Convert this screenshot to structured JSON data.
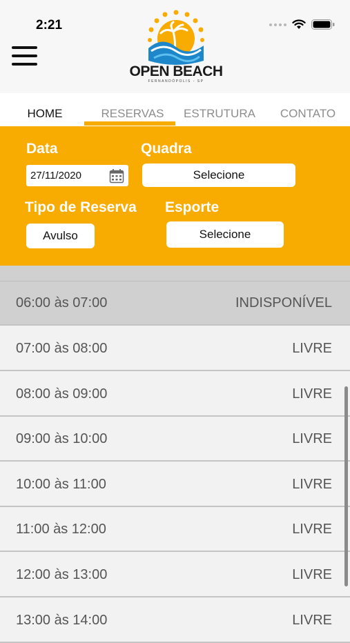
{
  "status_bar": {
    "time": "2:21"
  },
  "logo": {
    "title": "OPEN BEACH",
    "subtitle": "FERNANDÓPOLIS - SP"
  },
  "tabs": [
    {
      "label": "HOME"
    },
    {
      "label": "RESERVAS"
    },
    {
      "label": "ESTRUTURA"
    },
    {
      "label": "CONTATO"
    }
  ],
  "filters": {
    "data_label": "Data",
    "date_value": "27/11/2020",
    "quadra_label": "Quadra",
    "quadra_value": "Selecione",
    "tipo_label": "Tipo de Reserva",
    "tipo_value": "Avulso",
    "esporte_label": "Esporte",
    "esporte_value": "Selecione"
  },
  "slots": [
    {
      "time": "06:00 às 07:00",
      "status": "INDISPONÍVEL"
    },
    {
      "time": "07:00 às 08:00",
      "status": "LIVRE"
    },
    {
      "time": "08:00 às 09:00",
      "status": "LIVRE"
    },
    {
      "time": "09:00 às 10:00",
      "status": "LIVRE"
    },
    {
      "time": "10:00 às 11:00",
      "status": "LIVRE"
    },
    {
      "time": "11:00 às 12:00",
      "status": "LIVRE"
    },
    {
      "time": "12:00 às 13:00",
      "status": "LIVRE"
    },
    {
      "time": "13:00 às 14:00",
      "status": "LIVRE"
    }
  ],
  "colors": {
    "accent": "#f8ab00",
    "unavailable_row": "#d0d0d0",
    "row": "#f2f2f2"
  }
}
